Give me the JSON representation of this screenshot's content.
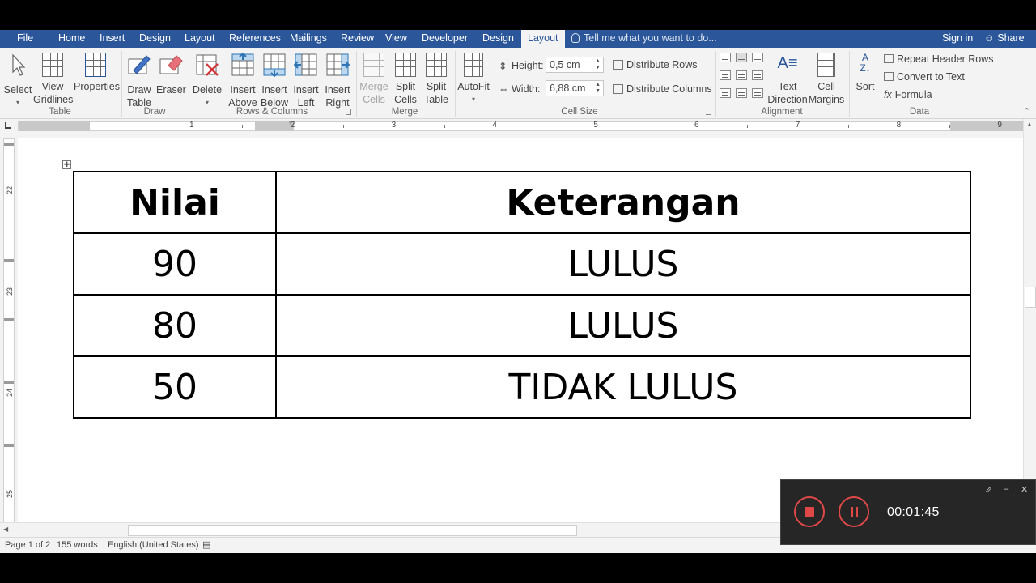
{
  "menu": {
    "file": "File",
    "home": "Home",
    "insert": "Insert",
    "design": "Design",
    "layout": "Layout",
    "references": "References",
    "mailings": "Mailings",
    "review": "Review",
    "view": "View",
    "developer": "Developer",
    "table_design": "Design",
    "table_layout": "Layout",
    "tell_me": "Tell me what you want to do...",
    "sign_in": "Sign in",
    "share": "Share",
    "accent_color": "#2b579a"
  },
  "ribbon": {
    "select": "Select",
    "view": "View",
    "gridlines": "Gridlines",
    "properties": "Properties",
    "group_table": "Table",
    "draw": "Draw",
    "table": "Table",
    "eraser": "Eraser",
    "group_draw": "Draw",
    "delete": "Delete",
    "insert": "Insert",
    "above": "Above",
    "below": "Below",
    "left": "Left",
    "right": "Right",
    "group_rows_cols": "Rows & Columns",
    "merge": "Merge",
    "cells": "Cells",
    "split": "Split",
    "split_cells": "Cells",
    "split_table": "Table",
    "group_merge": "Merge",
    "autofit": "AutoFit",
    "height_label": "Height:",
    "height_value": "0,5 cm",
    "width_label": "Width:",
    "width_value": "6,88 cm",
    "distribute_rows": "Distribute Rows",
    "distribute_columns": "Distribute Columns",
    "group_cell_size": "Cell Size",
    "text": "Text",
    "direction": "Direction",
    "cell": "Cell",
    "margins": "Margins",
    "group_alignment": "Alignment",
    "sort": "Sort",
    "repeat_header_rows": "Repeat Header Rows",
    "convert_to_text": "Convert to Text",
    "formula": "Formula",
    "group_data": "Data"
  },
  "ruler": {
    "numbers": [
      "1",
      "2",
      "3",
      "4",
      "5",
      "6",
      "7",
      "8",
      "9"
    ],
    "vnumbers": [
      "22",
      "23",
      "24",
      "25"
    ]
  },
  "document": {
    "header": [
      "Nilai",
      "Keterangan"
    ],
    "rows": [
      [
        "90",
        "LULUS"
      ],
      [
        "80",
        "LULUS"
      ],
      [
        "50",
        "TIDAK LULUS"
      ]
    ]
  },
  "status": {
    "page": "Page 1 of 2",
    "words": "155 words",
    "language": "English (United States)"
  },
  "recorder": {
    "time": "00:01:45"
  }
}
